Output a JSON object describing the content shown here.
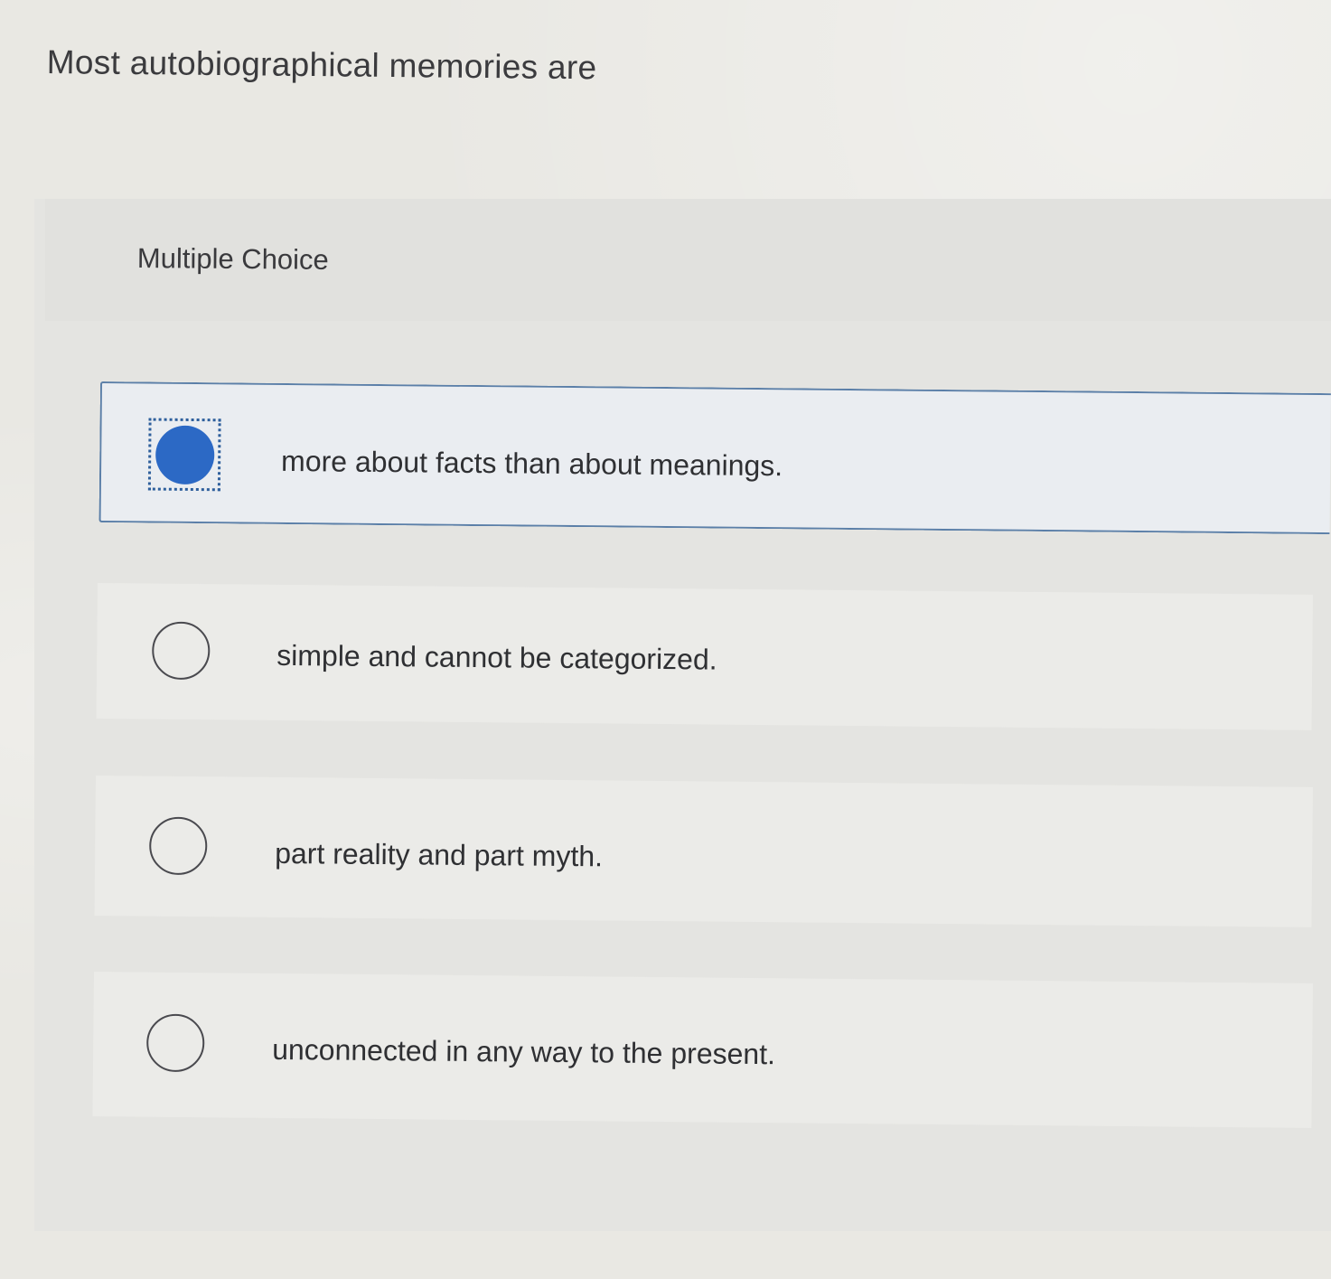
{
  "question": {
    "text": "Most autobiographical memories are"
  },
  "question_type": "Multiple Choice",
  "options": [
    {
      "label": "more about facts than about meanings.",
      "selected": true
    },
    {
      "label": "simple and cannot be categorized.",
      "selected": false
    },
    {
      "label": "part reality and part myth.",
      "selected": false
    },
    {
      "label": "unconnected in any way to the present.",
      "selected": false
    }
  ],
  "colors": {
    "selected_fill": "#2c69c5",
    "selected_border": "#5b7fa8"
  }
}
